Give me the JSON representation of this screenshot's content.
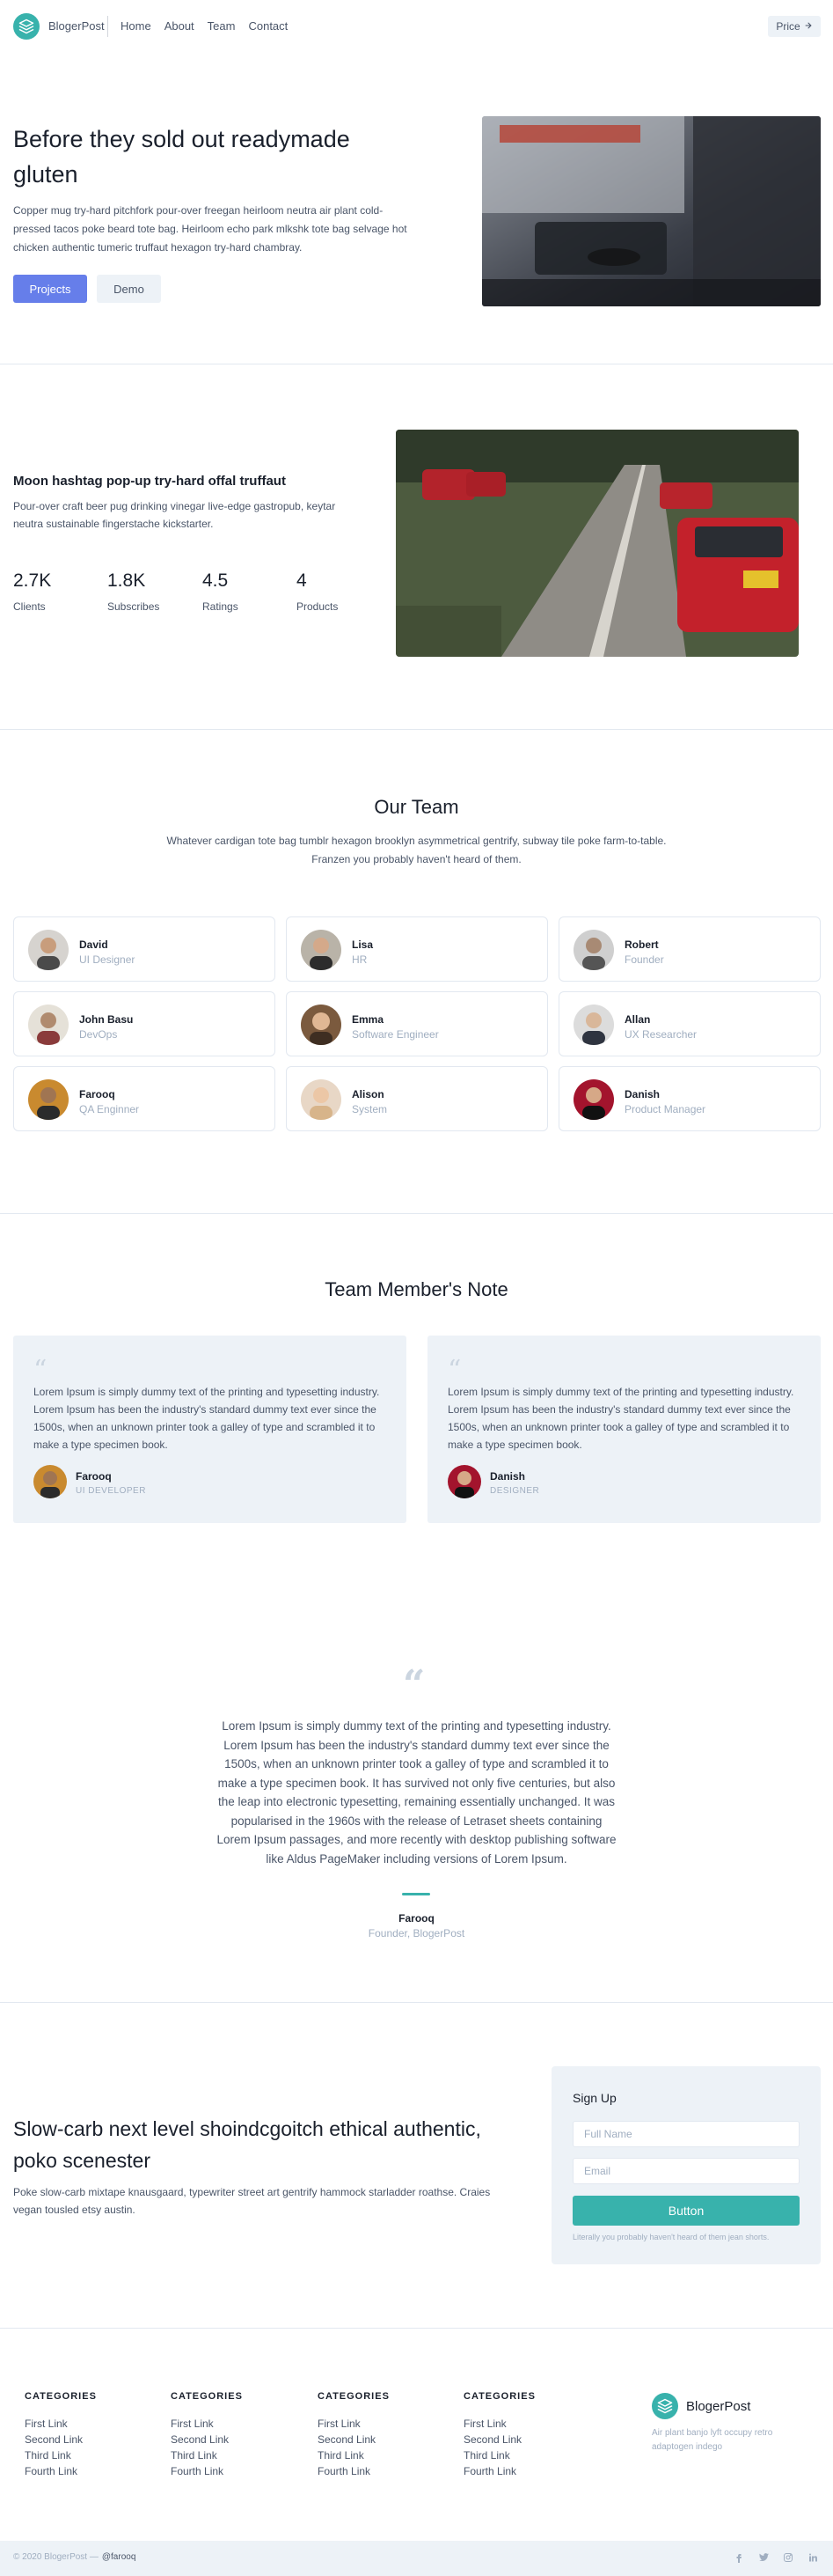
{
  "nav": {
    "brand": "BlogerPost",
    "links": [
      "Home",
      "About",
      "Team",
      "Contact"
    ],
    "price_button": "Price"
  },
  "hero": {
    "title": "Before they sold out readymade gluten",
    "text": "Copper mug try-hard pitchfork pour-over freegan heirloom neutra air plant cold-pressed tacos poke beard tote bag. Heirloom echo park mlkshk tote bag selvage hot chicken authentic tumeric truffaut hexagon try-hard chambray.",
    "primary_button": "Projects",
    "secondary_button": "Demo"
  },
  "stats": {
    "title": "Moon hashtag pop-up try-hard offal truffaut",
    "text": "Pour-over craft beer pug drinking vinegar live-edge gastropub, keytar neutra sustainable fingerstache kickstarter.",
    "items": [
      {
        "value": "2.7K",
        "label": "Clients"
      },
      {
        "value": "1.8K",
        "label": "Subscribes"
      },
      {
        "value": "4.5",
        "label": "Ratings"
      },
      {
        "value": "4",
        "label": "Products"
      }
    ]
  },
  "team": {
    "title": "Our Team",
    "text": "Whatever cardigan tote bag tumblr hexagon brooklyn asymmetrical gentrify, subway tile poke farm-to-table. Franzen you probably haven't heard of them.",
    "members": [
      {
        "name": "David",
        "role": "UI Designer"
      },
      {
        "name": "Lisa",
        "role": "HR"
      },
      {
        "name": "Robert",
        "role": "Founder"
      },
      {
        "name": "John Basu",
        "role": "DevOps"
      },
      {
        "name": "Emma",
        "role": "Software Engineer"
      },
      {
        "name": "Allan",
        "role": "UX Researcher"
      },
      {
        "name": "Farooq",
        "role": "QA Enginner"
      },
      {
        "name": "Alison",
        "role": "System"
      },
      {
        "name": "Danish",
        "role": "Product Manager"
      }
    ]
  },
  "notes": {
    "title": "Team Member's Note",
    "items": [
      {
        "text": "Lorem Ipsum is simply dummy text of the printing and typesetting industry. Lorem Ipsum has been the industry's standard dummy text ever since the 1500s, when an unknown printer took a galley of type and scrambled it to make a type specimen book.",
        "name": "Farooq",
        "role": "UI DEVELOPER"
      },
      {
        "text": "Lorem Ipsum is simply dummy text of the printing and typesetting industry. Lorem Ipsum has been the industry's standard dummy text ever since the 1500s, when an unknown printer took a galley of type and scrambled it to make a type specimen book.",
        "name": "Danish",
        "role": "DESIGNER"
      }
    ]
  },
  "testimonial": {
    "text": "Lorem Ipsum is simply dummy text of the printing and typesetting industry. Lorem Ipsum has been the industry's standard dummy text ever since the 1500s, when an unknown printer took a galley of type and scrambled it to make a type specimen book. It has survived not only five centuries, but also the leap into electronic typesetting, remaining essentially unchanged. It was popularised in the 1960s with the release of Letraset sheets containing Lorem Ipsum passages, and more recently with desktop publishing software like Aldus PageMaker including versions of Lorem Ipsum.",
    "name": "Farooq",
    "role": "Founder, BlogerPost"
  },
  "cta": {
    "title": "Slow-carb next level shoindcgoitch ethical authentic, poko scenester",
    "text": "Poke slow-carb mixtape knausgaard, typewriter street art gentrify hammock starladder roathse. Craies vegan tousled etsy austin.",
    "signup_title": "Sign Up",
    "name_placeholder": "Full Name",
    "email_placeholder": "Email",
    "button": "Button",
    "note": "Literally you probably haven't heard of them jean shorts."
  },
  "footer": {
    "columns": [
      {
        "heading": "CATEGORIES",
        "links": [
          "First Link",
          "Second Link",
          "Third Link",
          "Fourth Link"
        ]
      },
      {
        "heading": "CATEGORIES",
        "links": [
          "First Link",
          "Second Link",
          "Third Link",
          "Fourth Link"
        ]
      },
      {
        "heading": "CATEGORIES",
        "links": [
          "First Link",
          "Second Link",
          "Third Link",
          "Fourth Link"
        ]
      },
      {
        "heading": "CATEGORIES",
        "links": [
          "First Link",
          "Second Link",
          "Third Link",
          "Fourth Link"
        ]
      }
    ],
    "brand": "BlogerPost",
    "brand_text": "Air plant banjo lyft occupy retro adaptogen indego",
    "copyright": "© 2020 BlogerPost —",
    "handle": "@farooq",
    "social_icons": [
      "facebook-icon",
      "twitter-icon",
      "instagram-icon",
      "linkedin-icon"
    ]
  },
  "colors": {
    "accent_teal": "#38b2ac",
    "accent_indigo": "#667eea",
    "panel_gray": "#edf2f7"
  }
}
